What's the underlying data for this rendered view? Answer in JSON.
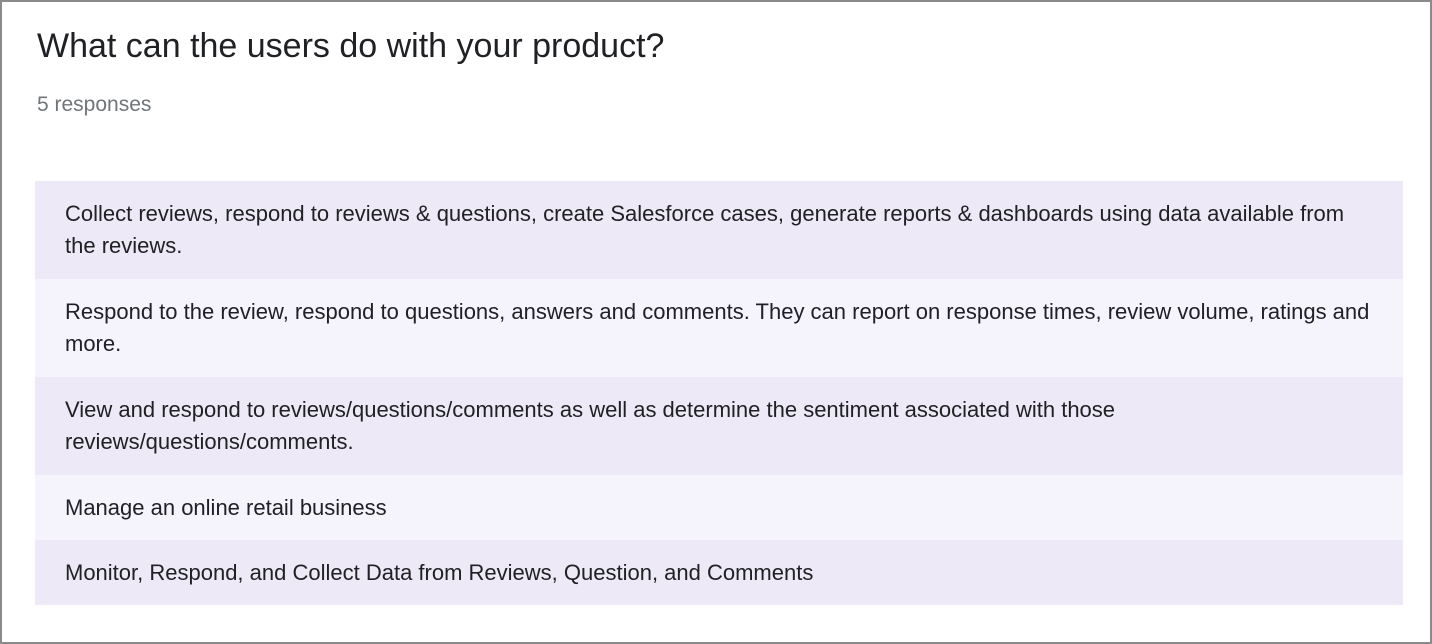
{
  "question": {
    "title": "What can the users do with your product?",
    "response_count": "5 responses"
  },
  "responses": [
    "Collect reviews, respond to reviews & questions, create Salesforce cases, generate reports & dashboards using data available from the reviews.",
    "Respond to the review, respond to questions, answers and comments. They can report on response times, review volume, ratings and more.",
    "View and respond to reviews/questions/comments as well as determine the sentiment associated with those reviews/questions/comments.",
    "Manage an online retail business",
    "Monitor, Respond, and Collect Data from Reviews, Question, and Comments"
  ],
  "colors": {
    "row_odd": "#ede9f7",
    "row_even": "#f5f3fb",
    "title_text": "#202124",
    "muted_text": "#70757a",
    "card_border": "#8a8a8a"
  }
}
